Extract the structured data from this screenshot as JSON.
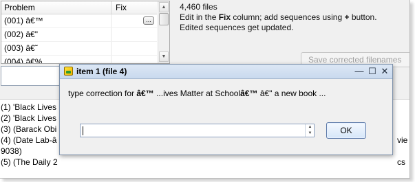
{
  "grid": {
    "headers": {
      "problem": "Problem",
      "fix": "Fix"
    },
    "rows": [
      {
        "problem": "(001) â€™"
      },
      {
        "problem": "(002) â€\""
      },
      {
        "problem": "(003) â€˜"
      },
      {
        "problem": "(004) â€%"
      }
    ],
    "ellipsis_label": "..."
  },
  "info": {
    "file_count": "4,460 files",
    "line2_prefix": "Edit in the ",
    "line2_bold": "Fix",
    "line2_mid": " column; add sequences using ",
    "line2_plus": "+",
    "line2_suffix": " button.",
    "line3": "Edited sequences get updated."
  },
  "save_button": "Save corrected filenames",
  "list_items": [
    "(1) 'Black Lives",
    "(2) 'Black Lives",
    "(3) (Barack Obi",
    "(4) (Date Lab-â",
    "9038)",
    "(5) (The Daily 2"
  ],
  "list_right_fragments": {
    "row4": "vie",
    "row5": "cs"
  },
  "dialog": {
    "title": "item 1 (file 4)",
    "prompt_prefix": "type correction for ",
    "prompt_bold1": "â€™",
    "prompt_mid": " ...ives Matter at School",
    "prompt_bold2": "â€™",
    "prompt_suffix": " â€\" a new book ...",
    "input_value": "",
    "ok_label": "OK"
  }
}
